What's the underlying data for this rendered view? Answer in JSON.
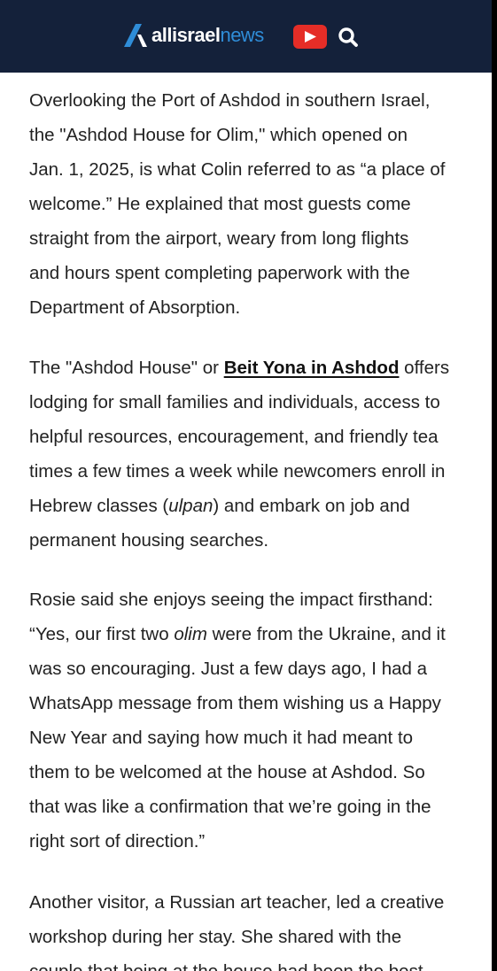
{
  "header": {
    "brand": {
      "strong": "allisrael",
      "light": "news"
    },
    "youtube_icon": "youtube-play-icon",
    "search_icon": "search-icon",
    "colors": {
      "background": "#14213a",
      "accent": "#2f8dd8",
      "youtube": "#e52d27"
    }
  },
  "article": {
    "p1": [
      "Overlooking the Port of Ashdod in southern Israel,",
      "the \"Ashdod House for Olim,\" which opened on",
      "Jan. 1, 2025, is what Colin referred to as “a place of",
      "welcome.” He explained that most guests come",
      "straight from the airport, weary from long flights",
      "and hours spent completing paperwork with the",
      "Department of Absorption."
    ],
    "p2": {
      "line1_before": "The \"Ashdod House\" or ",
      "link_text": "Beit Yona in Ashdod",
      "line1_after": " offers",
      "line2": "lodging for small families and individuals, access to",
      "line3": "helpful resources, encouragement, and friendly tea",
      "line4": "times a few times a week while newcomers enroll in",
      "line5_before": "Hebrew classes (",
      "line5_em": "ulpan",
      "line5_after": ") and embark on job and",
      "line6": "permanent housing searches."
    },
    "p3": {
      "line1": "Rosie said she enjoys seeing the impact firsthand:",
      "line2_before": "“Yes, our first two ",
      "line2_em": "olim",
      "line2_after": " were from the Ukraine, and it",
      "lines": [
        "was so encouraging. Just a few days ago, I had a",
        "WhatsApp message from them wishing us a Happy",
        "New Year and saying how much it had meant to",
        "them to be welcomed at the house at Ashdod. So",
        "that was like a confirmation that we’re going in the",
        "right sort of direction.”"
      ]
    },
    "p4": [
      "Another visitor, a Russian art teacher, led a creative",
      "workshop during her stay. She shared with the",
      "couple that being at the house had been the best"
    ]
  }
}
